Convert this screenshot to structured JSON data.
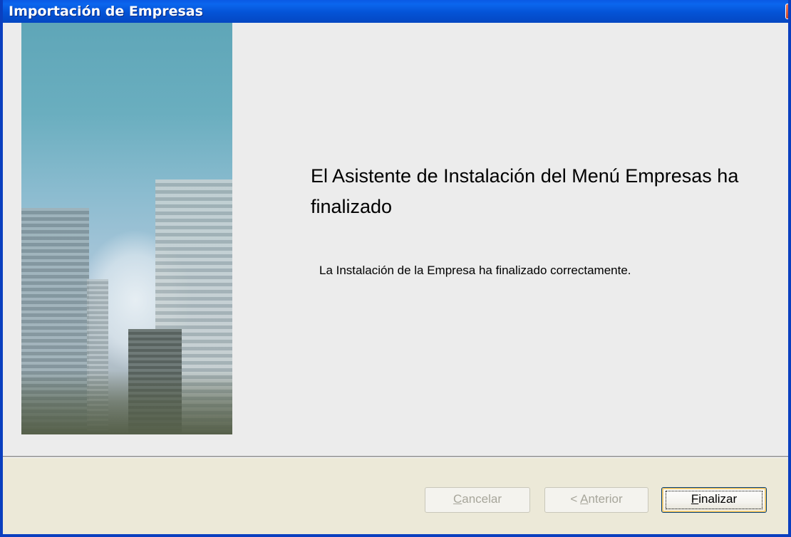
{
  "window": {
    "title": "Importación de Empresas",
    "close_glyph": "✕"
  },
  "main": {
    "heading": "El Asistente de Instalación del Menú Empresas ha finalizado",
    "message": "La Instalación de la Empresa ha finalizado correctamente."
  },
  "buttons": {
    "cancel_first": "C",
    "cancel_rest": "ancelar",
    "back_prefix": "< ",
    "back_first": "A",
    "back_rest": "nterior",
    "finish_first": "F",
    "finish_rest": "inalizar"
  },
  "colors": {
    "titlebar": "#0453d6",
    "dialog_bg": "#ececec",
    "button_border": "#003c74"
  },
  "icons": {
    "close": "close-icon",
    "sidebar_image": "city-buildings-image"
  }
}
